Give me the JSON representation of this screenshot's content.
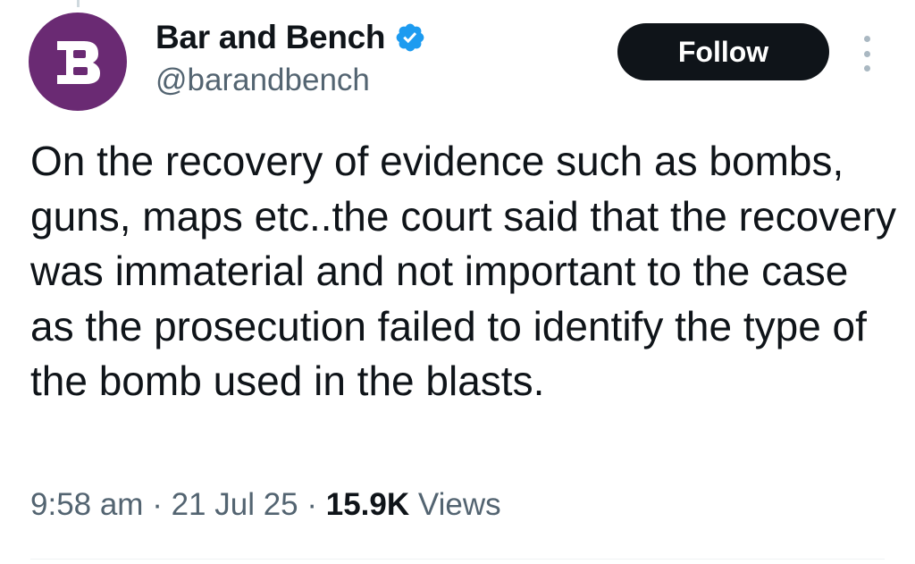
{
  "author": {
    "display_name": "Bar and Bench",
    "handle": "@barandbench",
    "verified": true,
    "avatar_bg": "#6a2a73"
  },
  "actions": {
    "follow_label": "Follow",
    "more_icon": "more-vertical-icon"
  },
  "tweet": {
    "text": "On the recovery of evidence such as bombs, guns, maps etc..the court said that the recovery was immaterial and not important to the case as the prosecution failed to identify the type of the bomb used in the blasts.",
    "time": "9:58 am",
    "date": "21 Jul 25",
    "separator": " · ",
    "views_count": "15.9K",
    "views_label": "Views"
  },
  "colors": {
    "text_primary": "#0f1419",
    "text_secondary": "#536471",
    "verified_blue": "#1d9bf0",
    "button_bg": "#0f1419"
  }
}
